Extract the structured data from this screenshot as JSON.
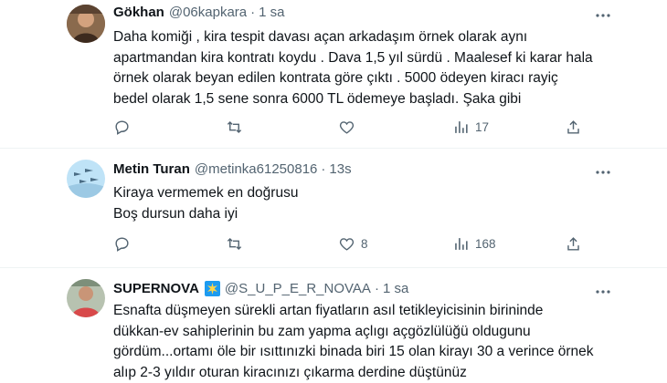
{
  "tweets": [
    {
      "name": "Gökhan",
      "handle": "@06kapkara",
      "separator": "·",
      "time": "1 sa",
      "lines": [
        "Daha komiği , kira tespit davası açan arkadaşım örnek olarak aynı",
        "apartmandan kira kontratı koydu . Dava 1,5 yıl sürdü . Maalesef ki karar hala",
        "örnek olarak beyan edilen kontrata göre çıktı . 5000 ödeyen kiracı rayiç",
        "bedel olarak 1,5 sene sonra 6000 TL ödemeye başladı. Şaka gibi"
      ],
      "likes": "",
      "views": "17"
    },
    {
      "name": "Metin Turan",
      "handle": "@metinka61250816",
      "separator": "·",
      "time": "13s",
      "lines": [
        "Kiraya vermemek en doğrusu",
        "Boş dursun daha iyi"
      ],
      "likes": "8",
      "views": "168"
    },
    {
      "name": "SUPERNOVA",
      "handle": "@S_U_P_E_R_NOVAA",
      "separator": "·",
      "time": "1 sa",
      "lines": [
        "Esnafta düşmeyen sürekli artan fiyatların asıl tetikleyicisinin birininde",
        "dükkan-ev sahiplerinin bu zam yapma açlıgı açgözlülüğü oldugunu",
        "gördüm...ortamı öle bir ısıttınızki binada biri 15 olan kirayı 30 a verince örnek",
        "alıp 2-3 yıldır oturan kiracınızı çıkarma derdine düştünüz"
      ]
    }
  ],
  "icons": {
    "reply": "reply-icon",
    "retweet": "retweet-icon",
    "like": "heart-icon",
    "views": "views-icon",
    "share": "share-icon",
    "more": "more-icon"
  },
  "colors": {
    "text": "#0f1419",
    "secondary": "#536471",
    "divider": "#eff3f4",
    "badge": "#1d9bf0"
  }
}
